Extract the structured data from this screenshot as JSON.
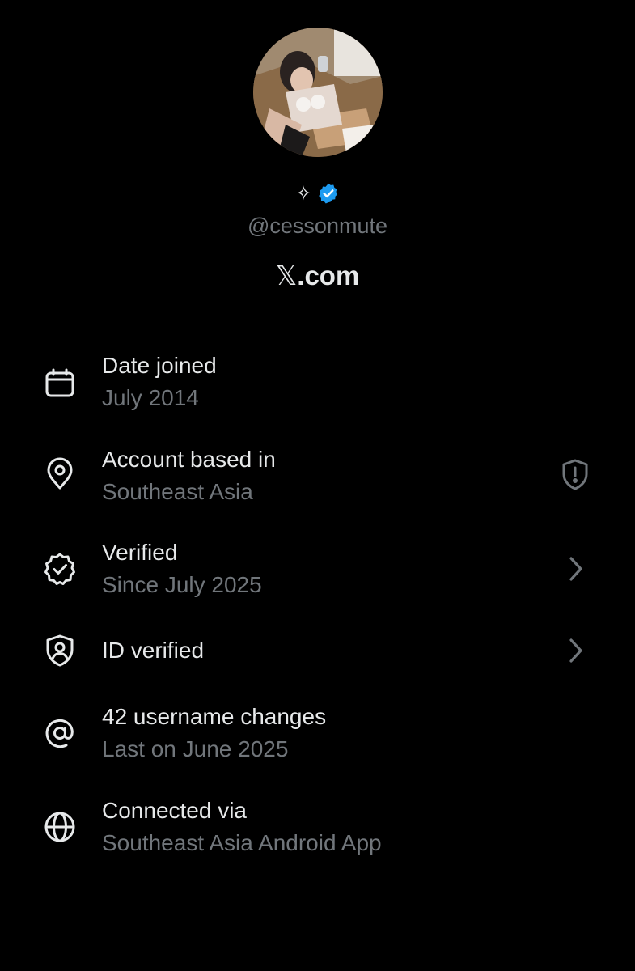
{
  "profile": {
    "avatar_alt": "profile photo",
    "display_name": "✧",
    "verified_badge_color": "#1d9bf0",
    "handle": "@cessonmute",
    "site_brand_x": "𝕏",
    "site_brand_rest": ".com"
  },
  "details": [
    {
      "title": "Date joined",
      "subtitle": "July 2014",
      "icon": "calendar-icon"
    },
    {
      "title": "Account based in",
      "subtitle": "Southeast Asia",
      "icon": "location-pin-icon",
      "trailing_icon": "shield-alert-icon"
    },
    {
      "title": "Verified",
      "subtitle": "Since July 2025",
      "icon": "verified-badge-outline-icon",
      "trailing_icon": "chevron-right-icon"
    },
    {
      "title": "ID verified",
      "subtitle": "",
      "icon": "id-shield-icon",
      "trailing_icon": "chevron-right-icon"
    },
    {
      "title": "42 username changes",
      "subtitle": "Last on June 2025",
      "icon": "at-sign-icon"
    },
    {
      "title": "Connected via",
      "subtitle": "Southeast Asia Android App",
      "icon": "globe-icon"
    }
  ],
  "colors": {
    "background": "#000000",
    "primary_text": "#e7e9ea",
    "secondary_text": "#71767b",
    "accent": "#1d9bf0"
  }
}
